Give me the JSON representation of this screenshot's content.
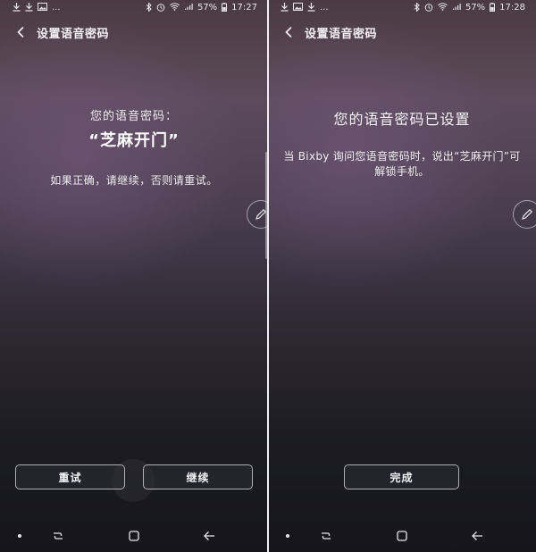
{
  "left_screen": {
    "status_bar": {
      "left_icons": [
        "download-icon",
        "download-icon",
        "image-icon"
      ],
      "ellipsis": "...",
      "battery": "57%",
      "time": "17:27"
    },
    "header": {
      "title": "设置语音密码"
    },
    "prompt_label": "您的语音密码：",
    "passphrase": "“芝麻开门”",
    "hint": "如果正确，请继续，否则请重试。",
    "buttons": {
      "retry": "重试",
      "continue": "继续"
    }
  },
  "right_screen": {
    "status_bar": {
      "left_icons": [
        "download-icon",
        "image-icon",
        "download-icon"
      ],
      "ellipsis": "...",
      "battery": "57%",
      "time": "17:28"
    },
    "header": {
      "title": "设置语音密码"
    },
    "done_title": "您的语音密码已设置",
    "done_desc": "当 Bixby 询问您语音密码时，说出“芝麻开门”可解锁手机。",
    "buttons": {
      "done": "完成"
    }
  }
}
